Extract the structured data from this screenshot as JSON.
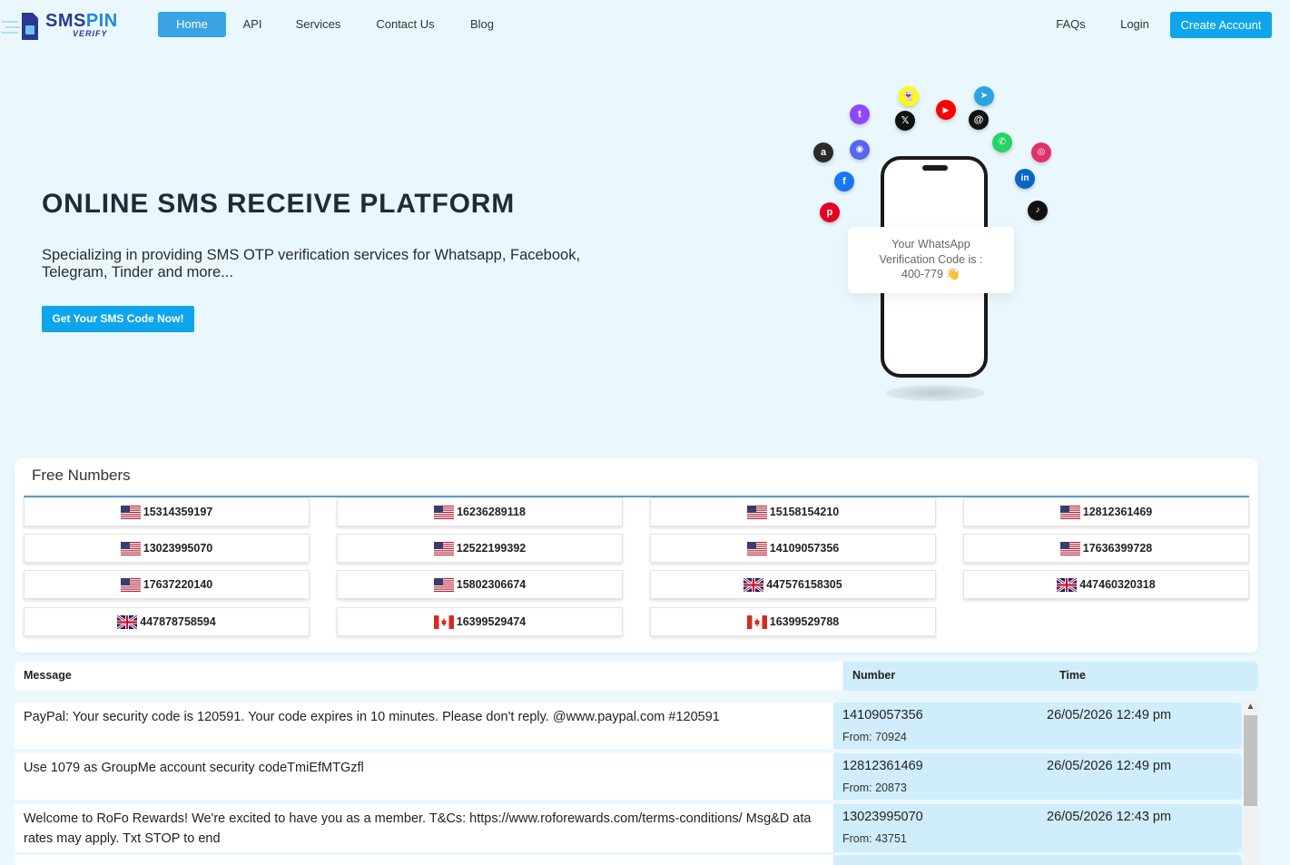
{
  "nav": {
    "logo_main": "SMSPIN",
    "logo_sms": "SMS",
    "logo_pin": "PIN",
    "logo_sub": "VERIFY",
    "items": [
      "Home",
      "API",
      "Services",
      "Contact Us",
      "Blog"
    ],
    "right_items": [
      "FAQs",
      "Login"
    ],
    "create_account": "Create Account"
  },
  "hero": {
    "title": "ONLINE SMS RECEIVE PLATFORM",
    "description": "Specializing in providing SMS OTP verification services for Whatsapp, Facebook, Telegram, Tinder and more...",
    "cta": "Get Your SMS Code Now!",
    "otp_line1": "Your WhatsApp",
    "otp_line2": "Verification Code is :",
    "otp_line3": "400-779 👋"
  },
  "free_numbers": {
    "title": "Free Numbers",
    "numbers": [
      {
        "number": "15314359197",
        "country": "us"
      },
      {
        "number": "16236289118",
        "country": "us"
      },
      {
        "number": "15158154210",
        "country": "us"
      },
      {
        "number": "12812361469",
        "country": "us"
      },
      {
        "number": "13023995070",
        "country": "us"
      },
      {
        "number": "12522199392",
        "country": "us"
      },
      {
        "number": "14109057356",
        "country": "us"
      },
      {
        "number": "17636399728",
        "country": "us"
      },
      {
        "number": "17637220140",
        "country": "us"
      },
      {
        "number": "15802306674",
        "country": "us"
      },
      {
        "number": "447576158305",
        "country": "uk"
      },
      {
        "number": "447460320318",
        "country": "uk"
      },
      {
        "number": "447878758594",
        "country": "uk"
      },
      {
        "number": "16399529474",
        "country": "ca"
      },
      {
        "number": "16399529788",
        "country": "ca"
      }
    ]
  },
  "messages": {
    "headers": {
      "message": "Message",
      "number": "Number",
      "time": "Time"
    },
    "rows": [
      {
        "message": "PayPal: Your security code is 120591. Your code expires in 10 minutes. Please don't reply. @www.paypal.com #120591",
        "number": "14109057356",
        "from": "From: 70924",
        "time": "26/05/2026 12:49 pm"
      },
      {
        "message": "Use 1079 as GroupMe account security codeTmiEfMTGzfl",
        "number": "12812361469",
        "from": "From: 20873",
        "time": "26/05/2026 12:49 pm"
      },
      {
        "message": "Welcome to RoFo Rewards! We're excited to have you as a member. T&Cs: https://www.roforewards.com/terms-conditions/ Msg&D ata rates may apply. Txt STOP to end",
        "number": "13023995070",
        "from": "From: 43751",
        "time": "26/05/2026 12:43 pm"
      }
    ]
  },
  "colors": {
    "accent": "#0ea5ec",
    "background": "#eaf8fd",
    "number_column": "#cfedfb"
  },
  "social_icons": [
    "snapchat-icon",
    "youtube-icon",
    "telegram-icon",
    "twitch-icon",
    "x-icon",
    "threads-icon",
    "discord-icon",
    "whatsapp-icon",
    "amazon-icon",
    "instagram-icon",
    "facebook-icon",
    "linkedin-icon",
    "pinterest-icon",
    "tiktok-icon"
  ]
}
